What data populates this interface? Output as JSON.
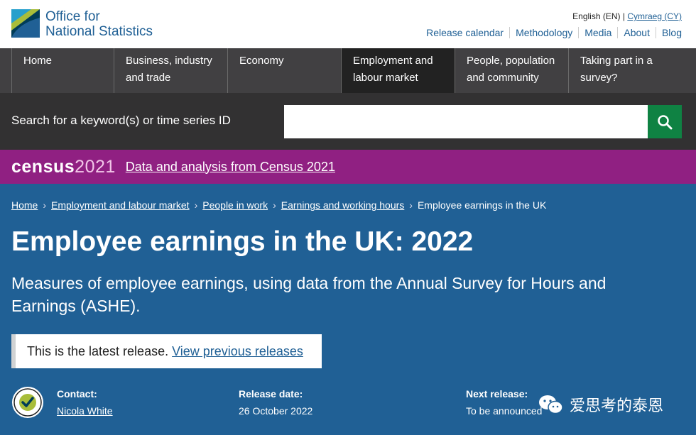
{
  "header": {
    "logo_line1": "Office for",
    "logo_line2": "National Statistics",
    "lang_en": "English (EN)",
    "lang_sep": "|",
    "lang_cy": "Cymraeg (CY)",
    "utility_links": [
      "Release calendar",
      "Methodology",
      "Media",
      "About",
      "Blog"
    ]
  },
  "nav": {
    "items": [
      "Home",
      "Business, industry and trade",
      "Economy",
      "Employment and labour market",
      "People, population and community",
      "Taking part in a survey?"
    ],
    "active_index": 3
  },
  "search": {
    "label": "Search for a keyword(s) or time series ID",
    "value": "",
    "icon": "search-icon"
  },
  "census": {
    "logo_word": "census",
    "logo_year": "2021",
    "link": "Data and analysis from Census 2021"
  },
  "breadcrumb": {
    "links": [
      "Home",
      "Employment and labour market",
      "People in work",
      "Earnings and working hours"
    ],
    "current": "Employee earnings in the UK"
  },
  "page": {
    "title": "Employee earnings in the UK: 2022",
    "description": "Measures of employee earnings, using data from the Annual Survey for Hours and Earnings (ASHE).",
    "release_note": "This is the latest release.",
    "release_link": "View previous releases"
  },
  "meta": {
    "contact_label": "Contact:",
    "contact_name": "Nicola White",
    "release_date_label": "Release date:",
    "release_date": "26 October 2022",
    "next_release_label": "Next release:",
    "next_release": "To be announced"
  },
  "watermark": "爱思考的泰恩",
  "colors": {
    "brand_blue": "#206095",
    "nav_bg": "#414042",
    "nav_active": "#222222",
    "search_bg": "#323132",
    "search_button": "#0f8243",
    "census_purple": "#902082"
  }
}
